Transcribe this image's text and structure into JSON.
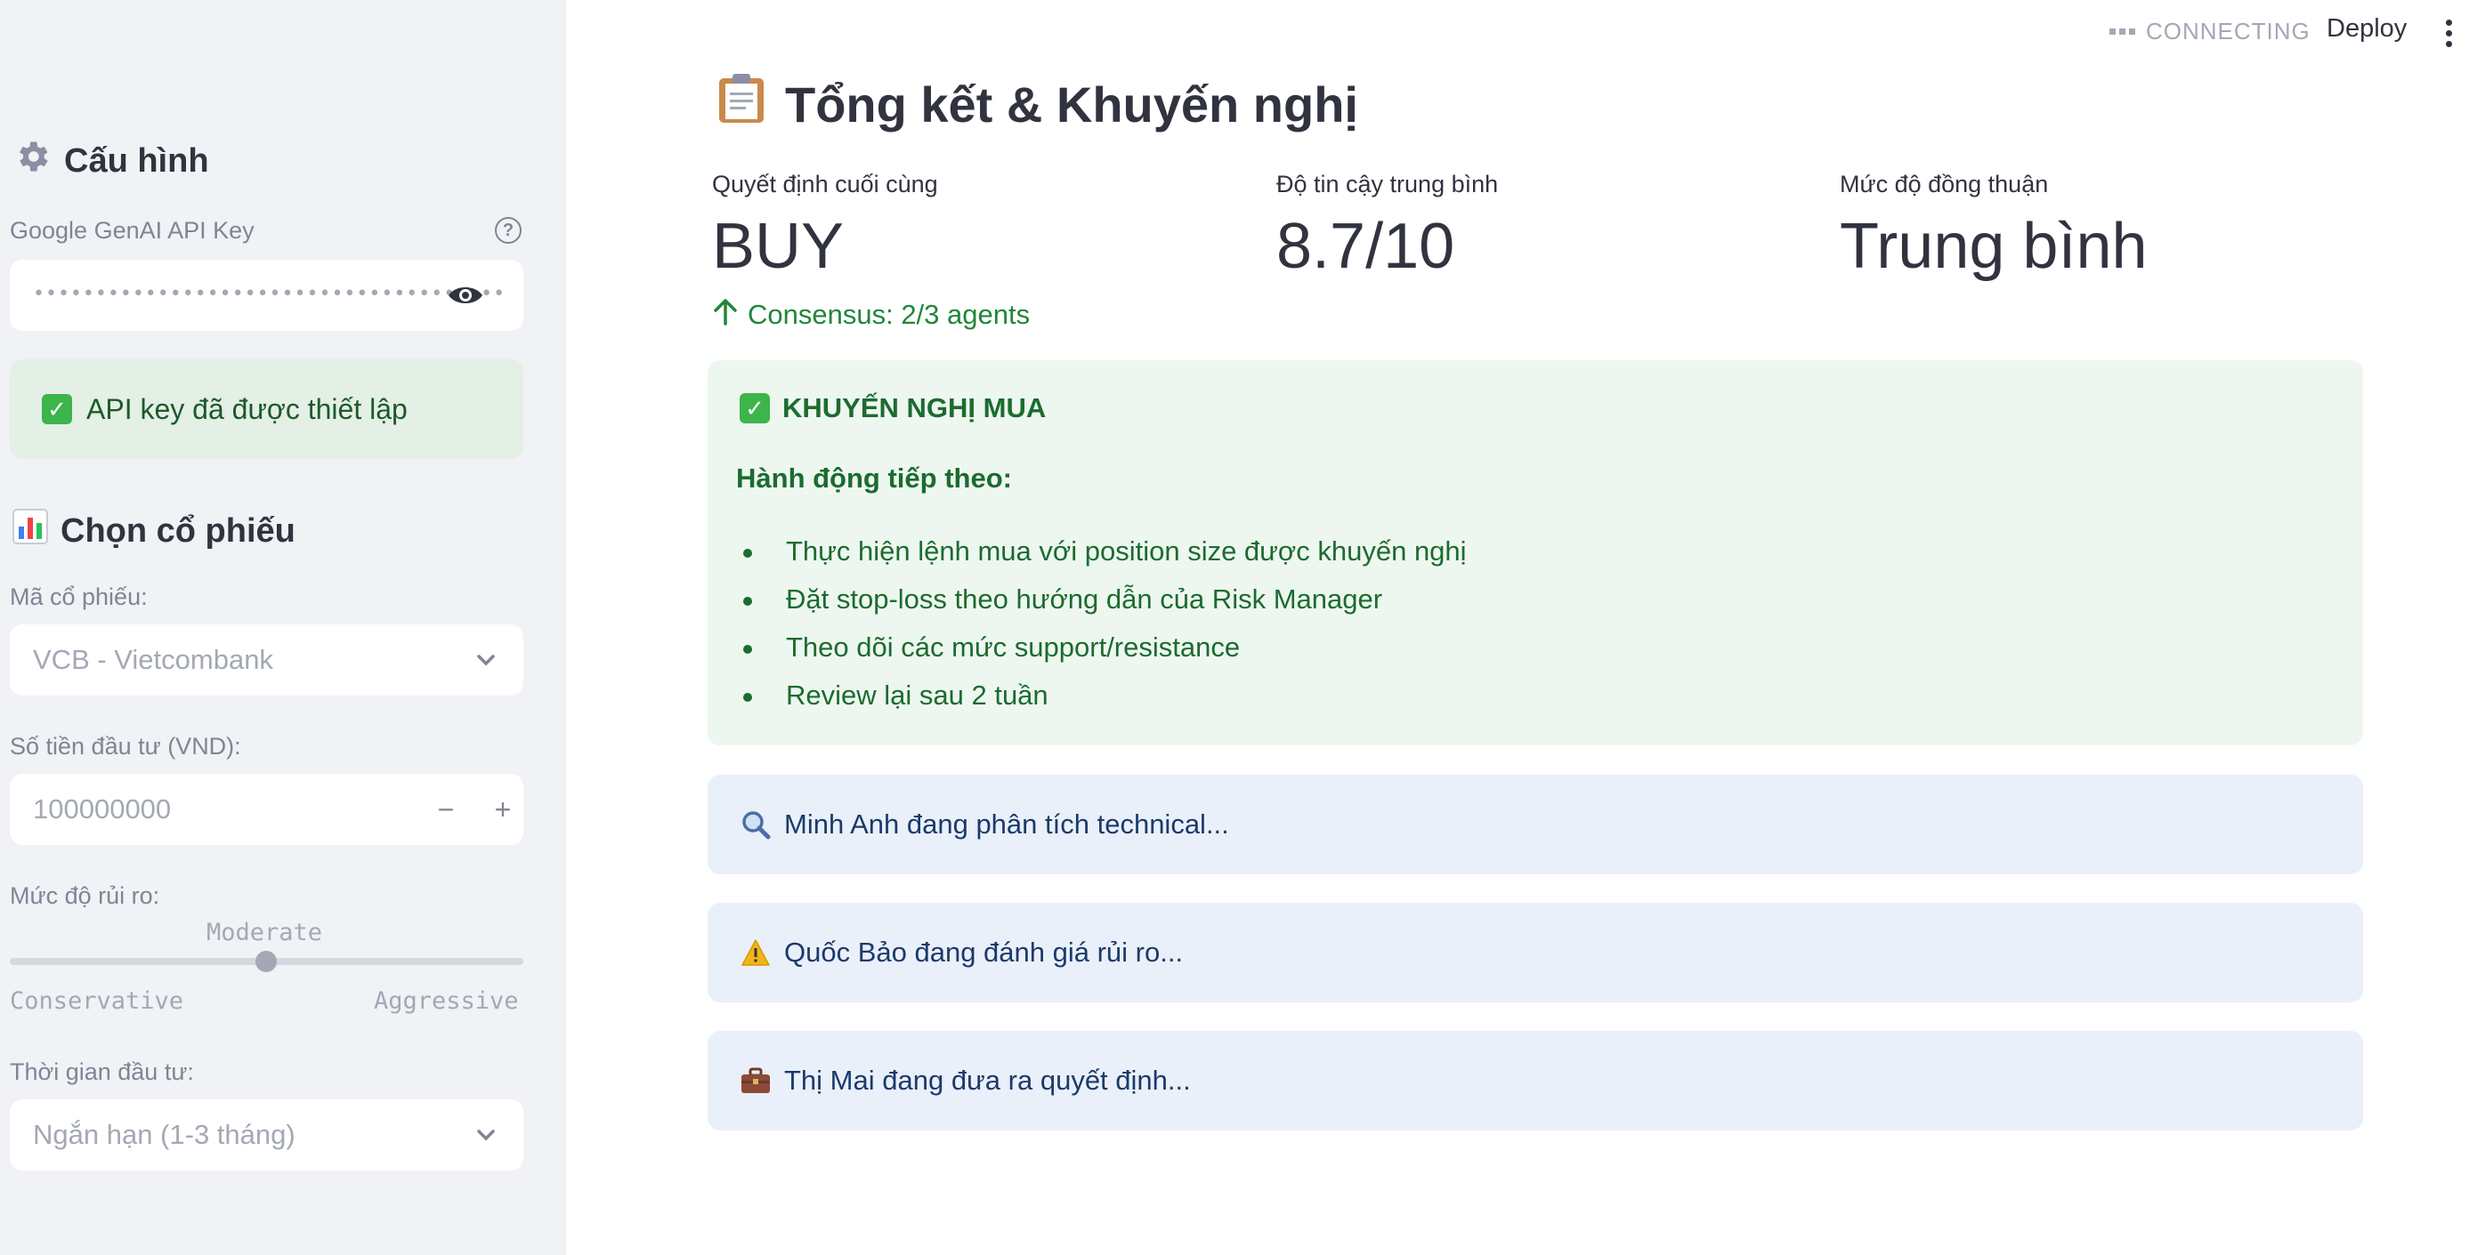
{
  "header": {
    "status_text": "CONNECTING",
    "deploy_label": "Deploy"
  },
  "sidebar": {
    "config_heading": "Cấu hình",
    "api_key": {
      "label": "Google GenAI API Key",
      "masked_value": "••••••••••••••••••••••••••••••••••••••"
    },
    "api_success": "API key đã được thiết lập",
    "stock_heading": "Chọn cổ phiếu",
    "stock_select": {
      "label": "Mã cổ phiếu:",
      "value": "VCB - Vietcombank"
    },
    "investment": {
      "label": "Số tiền đầu tư (VND):",
      "value": "100000000",
      "minus": "−",
      "plus": "+"
    },
    "risk": {
      "label": "Mức độ rủi ro:",
      "current": "Moderate",
      "min_label": "Conservative",
      "max_label": "Aggressive",
      "level_fraction": 0.5
    },
    "horizon": {
      "label": "Thời gian đầu tư:",
      "value": "Ngắn hạn (1-3 tháng)"
    }
  },
  "main": {
    "title": "Tổng kết & Khuyến nghị",
    "metrics": [
      {
        "label": "Quyết định cuối cùng",
        "value": "BUY"
      },
      {
        "label": "Độ tin cậy trung bình",
        "value": "8.7/10"
      },
      {
        "label": "Mức độ đồng thuận",
        "value": "Trung bình"
      }
    ],
    "consensus": "Consensus: 2/3 agents",
    "recommendation": {
      "title": "KHUYẾN NGHỊ MUA",
      "subtitle": "Hành động tiếp theo:",
      "items": [
        "Thực hiện lệnh mua với position size được khuyến nghị",
        "Đặt stop-loss theo hướng dẫn của Risk Manager",
        "Theo dõi các mức support/resistance",
        "Review lại sau 2 tuần"
      ]
    },
    "agents": [
      {
        "icon": "magnifier-icon",
        "text": "Minh Anh đang phân tích technical..."
      },
      {
        "icon": "warning-icon",
        "text": "Quốc Bảo đang đánh giá rủi ro..."
      },
      {
        "icon": "briefcase-icon",
        "text": "Thị Mai đang đưa ra quyết định..."
      }
    ]
  },
  "colors": {
    "sidebar_bg": "#f0f2f6",
    "success_bg": "#e4efe5",
    "success_text": "#1c6b30",
    "info_bg": "#eaf0f9",
    "info_text": "#1b3a6b",
    "delta_green": "#21863a"
  }
}
